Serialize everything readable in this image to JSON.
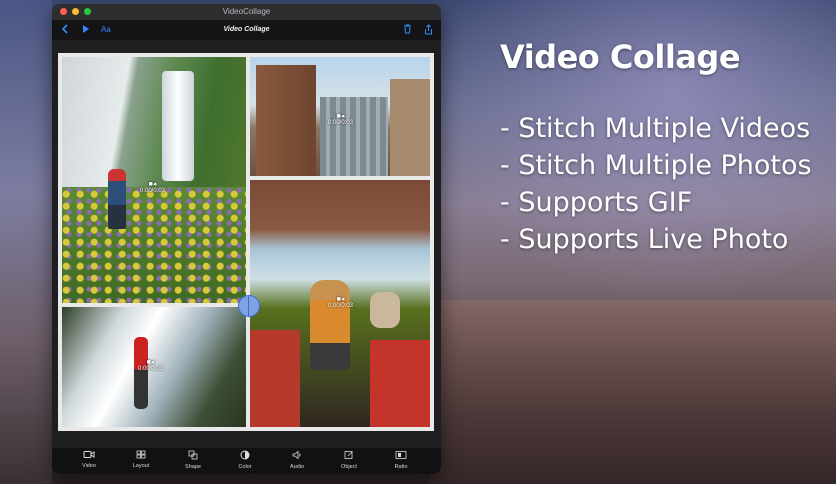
{
  "window": {
    "title": "VideoCollage",
    "traffic_lights": [
      "close",
      "minimize",
      "zoom"
    ]
  },
  "toolbar": {
    "back_icon": "chevron-left-icon",
    "play_icon": "play-icon",
    "font_label": "Aa",
    "title": "Video Collage",
    "trash_icon": "trash-icon",
    "share_icon": "share-icon"
  },
  "collage": {
    "cells": [
      {
        "id": "waterfall-hiker",
        "duration": "0:00/0:03"
      },
      {
        "id": "city-skyline",
        "duration": "0:00/0:03"
      },
      {
        "id": "car-dog",
        "duration": "0:00/0:03"
      },
      {
        "id": "waterfall-person",
        "duration": "0:00/0:03"
      }
    ]
  },
  "bottom_tabs": [
    {
      "label": "Video",
      "icon": "video-icon"
    },
    {
      "label": "Layout",
      "icon": "layout-grid-icon"
    },
    {
      "label": "Shape",
      "icon": "shape-icon"
    },
    {
      "label": "Color",
      "icon": "color-icon"
    },
    {
      "label": "Audio",
      "icon": "speaker-icon"
    },
    {
      "label": "Object",
      "icon": "object-icon"
    },
    {
      "label": "Ratio",
      "icon": "ratio-icon"
    }
  ],
  "promo": {
    "title": "Video Collage",
    "features": [
      "- Stitch Multiple Videos",
      "- Stitch Multiple Photos",
      "- Supports GIF",
      "- Supports Live Photo"
    ]
  },
  "colors": {
    "accent": "#2f8cff",
    "handle": "#7ea2e2"
  }
}
